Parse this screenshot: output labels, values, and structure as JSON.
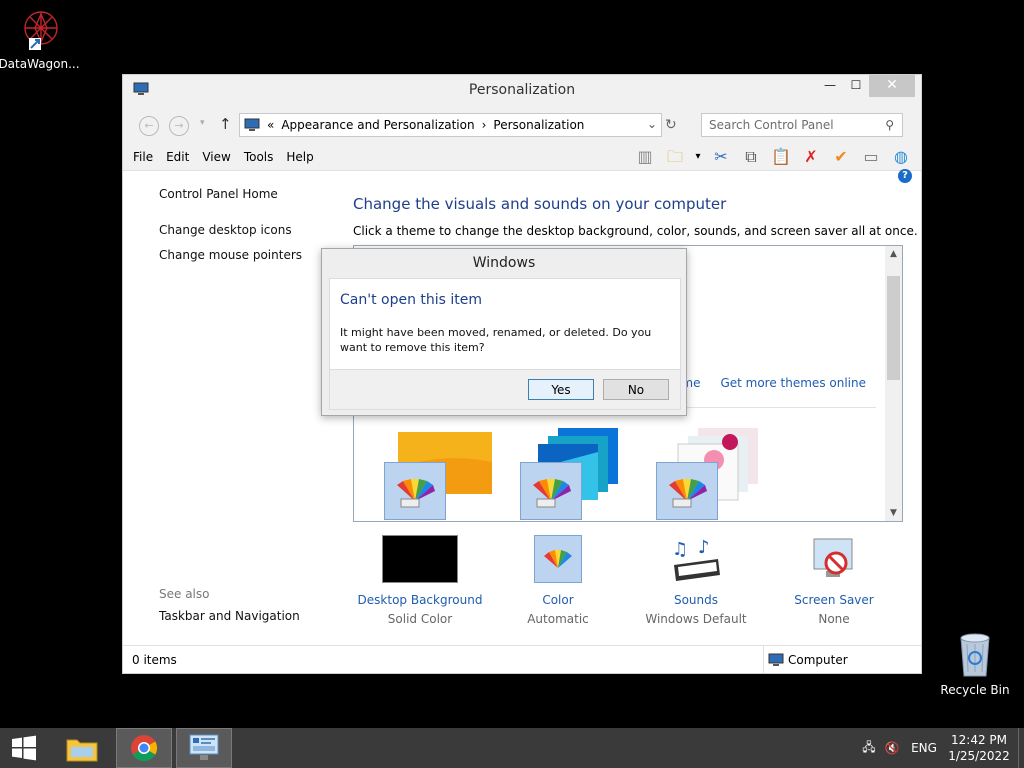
{
  "desktop": {
    "icon1_label": "DataWagon...",
    "icon2_label": "Recycle Bin"
  },
  "window": {
    "title": "Personalization",
    "minimize": "—",
    "maximize": "☐",
    "close": "✕",
    "address": {
      "prefix": "«",
      "crumb1": "Appearance and Personalization",
      "sep": "›",
      "crumb2": "Personalization"
    },
    "search_placeholder": "Search Control Panel",
    "menu": [
      "File",
      "Edit",
      "View",
      "Tools",
      "Help"
    ],
    "sidebar": {
      "home": "Control Panel Home",
      "links": [
        "Change desktop icons",
        "Change mouse pointers"
      ],
      "see_also": "See also",
      "see_also_link": "Taskbar and Navigation"
    },
    "main": {
      "title": "Change the visuals and sounds on your computer",
      "description": "Click a theme to change the desktop background, color, sounds, and screen saver all at once.",
      "theme_link_partial": "theme",
      "get_more_themes": "Get more themes online"
    },
    "bottom": [
      {
        "label": "Desktop Background",
        "sub": "Solid Color"
      },
      {
        "label": "Color",
        "sub": "Automatic"
      },
      {
        "label": "Sounds",
        "sub": "Windows Default"
      },
      {
        "label": "Screen Saver",
        "sub": "None"
      }
    ],
    "status": {
      "items": "0 items",
      "location": "Computer"
    }
  },
  "dialog": {
    "title": "Windows",
    "heading": "Can't open this item",
    "message": "It might have been moved, renamed, or deleted. Do you want to remove this item?",
    "yes": "Yes",
    "no": "No"
  },
  "taskbar": {
    "language": "ENG",
    "time": "12:42 PM",
    "date": "1/25/2022"
  }
}
